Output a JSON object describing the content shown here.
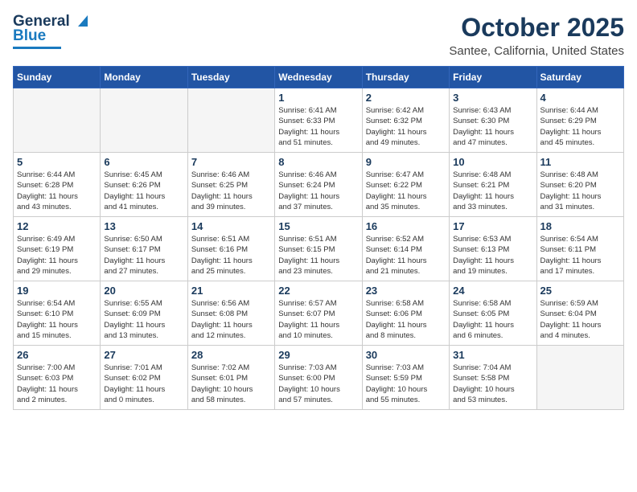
{
  "header": {
    "logo_line1": "General",
    "logo_line2": "Blue",
    "title": "October 2025",
    "subtitle": "Santee, California, United States"
  },
  "weekdays": [
    "Sunday",
    "Monday",
    "Tuesday",
    "Wednesday",
    "Thursday",
    "Friday",
    "Saturday"
  ],
  "weeks": [
    [
      {
        "day": "",
        "info": ""
      },
      {
        "day": "",
        "info": ""
      },
      {
        "day": "",
        "info": ""
      },
      {
        "day": "1",
        "info": "Sunrise: 6:41 AM\nSunset: 6:33 PM\nDaylight: 11 hours\nand 51 minutes."
      },
      {
        "day": "2",
        "info": "Sunrise: 6:42 AM\nSunset: 6:32 PM\nDaylight: 11 hours\nand 49 minutes."
      },
      {
        "day": "3",
        "info": "Sunrise: 6:43 AM\nSunset: 6:30 PM\nDaylight: 11 hours\nand 47 minutes."
      },
      {
        "day": "4",
        "info": "Sunrise: 6:44 AM\nSunset: 6:29 PM\nDaylight: 11 hours\nand 45 minutes."
      }
    ],
    [
      {
        "day": "5",
        "info": "Sunrise: 6:44 AM\nSunset: 6:28 PM\nDaylight: 11 hours\nand 43 minutes."
      },
      {
        "day": "6",
        "info": "Sunrise: 6:45 AM\nSunset: 6:26 PM\nDaylight: 11 hours\nand 41 minutes."
      },
      {
        "day": "7",
        "info": "Sunrise: 6:46 AM\nSunset: 6:25 PM\nDaylight: 11 hours\nand 39 minutes."
      },
      {
        "day": "8",
        "info": "Sunrise: 6:46 AM\nSunset: 6:24 PM\nDaylight: 11 hours\nand 37 minutes."
      },
      {
        "day": "9",
        "info": "Sunrise: 6:47 AM\nSunset: 6:22 PM\nDaylight: 11 hours\nand 35 minutes."
      },
      {
        "day": "10",
        "info": "Sunrise: 6:48 AM\nSunset: 6:21 PM\nDaylight: 11 hours\nand 33 minutes."
      },
      {
        "day": "11",
        "info": "Sunrise: 6:48 AM\nSunset: 6:20 PM\nDaylight: 11 hours\nand 31 minutes."
      }
    ],
    [
      {
        "day": "12",
        "info": "Sunrise: 6:49 AM\nSunset: 6:19 PM\nDaylight: 11 hours\nand 29 minutes."
      },
      {
        "day": "13",
        "info": "Sunrise: 6:50 AM\nSunset: 6:17 PM\nDaylight: 11 hours\nand 27 minutes."
      },
      {
        "day": "14",
        "info": "Sunrise: 6:51 AM\nSunset: 6:16 PM\nDaylight: 11 hours\nand 25 minutes."
      },
      {
        "day": "15",
        "info": "Sunrise: 6:51 AM\nSunset: 6:15 PM\nDaylight: 11 hours\nand 23 minutes."
      },
      {
        "day": "16",
        "info": "Sunrise: 6:52 AM\nSunset: 6:14 PM\nDaylight: 11 hours\nand 21 minutes."
      },
      {
        "day": "17",
        "info": "Sunrise: 6:53 AM\nSunset: 6:13 PM\nDaylight: 11 hours\nand 19 minutes."
      },
      {
        "day": "18",
        "info": "Sunrise: 6:54 AM\nSunset: 6:11 PM\nDaylight: 11 hours\nand 17 minutes."
      }
    ],
    [
      {
        "day": "19",
        "info": "Sunrise: 6:54 AM\nSunset: 6:10 PM\nDaylight: 11 hours\nand 15 minutes."
      },
      {
        "day": "20",
        "info": "Sunrise: 6:55 AM\nSunset: 6:09 PM\nDaylight: 11 hours\nand 13 minutes."
      },
      {
        "day": "21",
        "info": "Sunrise: 6:56 AM\nSunset: 6:08 PM\nDaylight: 11 hours\nand 12 minutes."
      },
      {
        "day": "22",
        "info": "Sunrise: 6:57 AM\nSunset: 6:07 PM\nDaylight: 11 hours\nand 10 minutes."
      },
      {
        "day": "23",
        "info": "Sunrise: 6:58 AM\nSunset: 6:06 PM\nDaylight: 11 hours\nand 8 minutes."
      },
      {
        "day": "24",
        "info": "Sunrise: 6:58 AM\nSunset: 6:05 PM\nDaylight: 11 hours\nand 6 minutes."
      },
      {
        "day": "25",
        "info": "Sunrise: 6:59 AM\nSunset: 6:04 PM\nDaylight: 11 hours\nand 4 minutes."
      }
    ],
    [
      {
        "day": "26",
        "info": "Sunrise: 7:00 AM\nSunset: 6:03 PM\nDaylight: 11 hours\nand 2 minutes."
      },
      {
        "day": "27",
        "info": "Sunrise: 7:01 AM\nSunset: 6:02 PM\nDaylight: 11 hours\nand 0 minutes."
      },
      {
        "day": "28",
        "info": "Sunrise: 7:02 AM\nSunset: 6:01 PM\nDaylight: 10 hours\nand 58 minutes."
      },
      {
        "day": "29",
        "info": "Sunrise: 7:03 AM\nSunset: 6:00 PM\nDaylight: 10 hours\nand 57 minutes."
      },
      {
        "day": "30",
        "info": "Sunrise: 7:03 AM\nSunset: 5:59 PM\nDaylight: 10 hours\nand 55 minutes."
      },
      {
        "day": "31",
        "info": "Sunrise: 7:04 AM\nSunset: 5:58 PM\nDaylight: 10 hours\nand 53 minutes."
      },
      {
        "day": "",
        "info": ""
      }
    ]
  ]
}
